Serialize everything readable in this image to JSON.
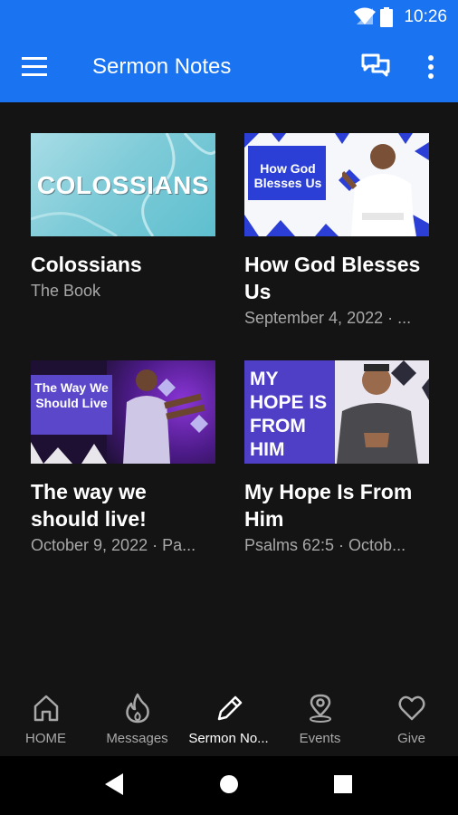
{
  "status_bar": {
    "time": "10:26"
  },
  "app_bar": {
    "title": "Sermon Notes"
  },
  "sermons": [
    {
      "title": "Colossians",
      "subtitle": "The Book",
      "thumb_text": "COLOSSIANS"
    },
    {
      "title": "How God Blesses Us",
      "subtitle": "September 4, 2022 · ...",
      "thumb_text": "How God Blesses Us"
    },
    {
      "title": "The way we should live!",
      "subtitle": "October 9, 2022 · Pa...",
      "thumb_text": "The Way We Should Live"
    },
    {
      "title": "My Hope Is From Him",
      "subtitle": "Psalms 62:5 · Octob...",
      "thumb_text": "MY HOPE IS FROM HIM"
    }
  ],
  "bottom_nav": {
    "items": [
      {
        "label": "HOME",
        "icon": "home-icon"
      },
      {
        "label": "Messages",
        "icon": "flame-icon"
      },
      {
        "label": "Sermon No...",
        "icon": "pencil-icon",
        "active": true
      },
      {
        "label": "Events",
        "icon": "location-pin-icon"
      },
      {
        "label": "Give",
        "icon": "heart-icon"
      }
    ]
  },
  "colors": {
    "app_bar": "#1a73f0",
    "background": "#141414",
    "subtitle": "#a8a8a8"
  }
}
